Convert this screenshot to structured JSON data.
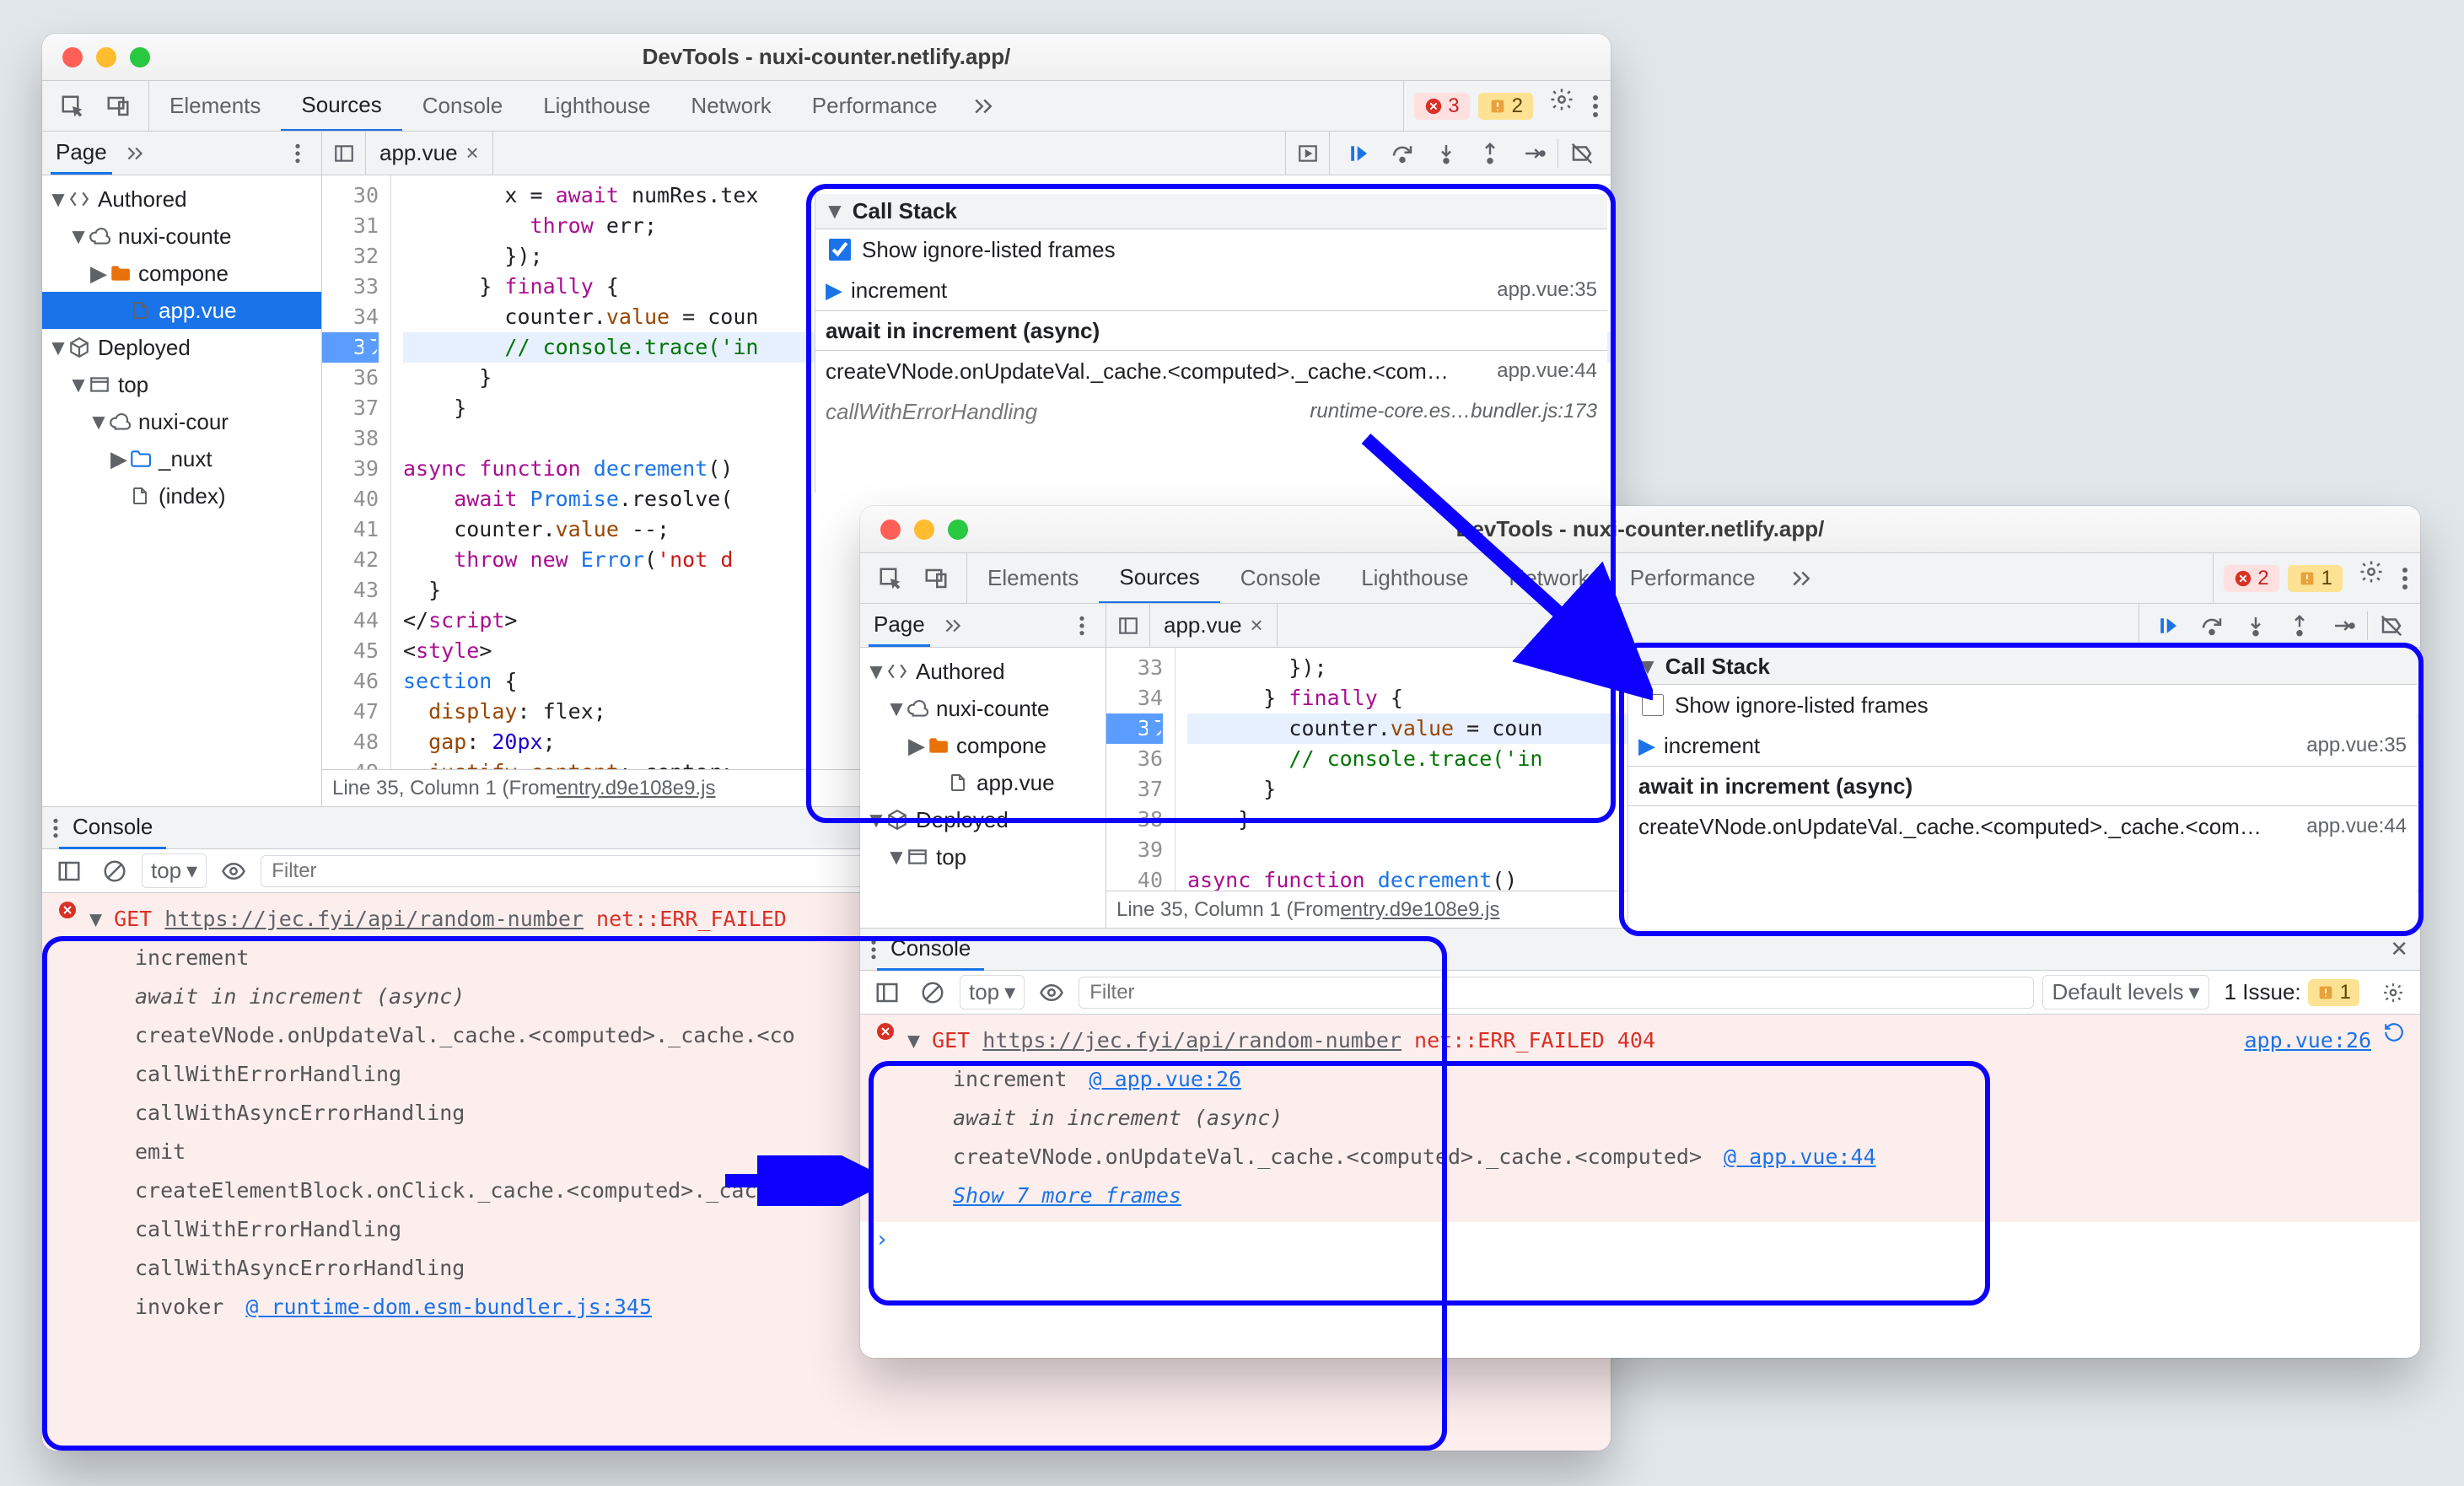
{
  "windowA": {
    "title": "DevTools - nuxi-counter.netlify.app/",
    "tabs": [
      "Elements",
      "Sources",
      "Console",
      "Lighthouse",
      "Network",
      "Performance"
    ],
    "activeTab": "Sources",
    "badges": {
      "errors": "3",
      "warnings": "2"
    },
    "pageTabLabel": "Page",
    "fileTab": "app.vue",
    "navigator": [
      {
        "depth": 0,
        "twist": "down",
        "icon": "brackets",
        "label": "Authored"
      },
      {
        "depth": 1,
        "twist": "down",
        "icon": "cloud",
        "label": "nuxi-counte"
      },
      {
        "depth": 2,
        "twist": "right",
        "icon": "folder",
        "label": "compone"
      },
      {
        "depth": 3,
        "twist": "none",
        "icon": "file",
        "label": "app.vue",
        "selected": true
      },
      {
        "depth": 0,
        "twist": "down",
        "icon": "cube",
        "label": "Deployed"
      },
      {
        "depth": 1,
        "twist": "down",
        "icon": "window",
        "label": "top"
      },
      {
        "depth": 2,
        "twist": "down",
        "icon": "cloud",
        "label": "nuxi-cour"
      },
      {
        "depth": 3,
        "twist": "right",
        "icon": "folder-b",
        "label": "_nuxt"
      },
      {
        "depth": 3,
        "twist": "none",
        "icon": "file",
        "label": "(index)"
      }
    ],
    "code": {
      "start": 30,
      "execLine": 35,
      "lines": [
        "        x = <kw>await</kw> numRes.tex",
        "          <kw>throw</kw> err;",
        "        });",
        "      } <kw>finally</kw> {",
        "        counter.<pr>value</pr> = coun",
        "        <cm>// console.trace('in</cm>",
        "      }",
        "    }",
        "",
        "<kw>async function</kw> <fn>decrement</fn>()",
        "    <kw>await</kw> <fn>Promise</fn>.resolve(",
        "    counter.<pr>value</pr> --;",
        "    <kw>throw new</kw> <fn>Error</fn>(<st>'not d</st>",
        "  }",
        "&lt;/<kw>script</kw>&gt;",
        "&lt;<kw>style</kw>&gt;",
        "<fn>section</fn> {",
        "  <pr>display</pr>: flex;",
        "  <pr>gap</pr>: <nm>20px</nm>;",
        "  <pr>justify-content</pr>: center;"
      ],
      "status": {
        "pos": "Line 35, Column 1",
        "from": "(From ",
        "link": "entry.d9e108e9.js"
      }
    },
    "callstack": {
      "title": "Call Stack",
      "checkbox": "Show ignore-listed frames",
      "checked": true,
      "rows": [
        {
          "kind": "ptr",
          "name": "increment",
          "loc": "app.vue:35"
        },
        {
          "kind": "bold",
          "name": "await in increment (async)"
        },
        {
          "kind": "wrap",
          "name": "createVNode.onUpdateVal._cache.<computed>._cache.<com…",
          "loc": "app.vue:44"
        },
        {
          "kind": "ital",
          "name": "callWithErrorHandling",
          "loc": "runtime-core.es…bundler.js:173"
        }
      ]
    },
    "console": {
      "title": "Console",
      "context": "top",
      "filterPlaceholder": "Filter",
      "err": "GET ",
      "errUrl": "https://jec.fyi/api/random-number",
      "errCode": " net::ERR_FAILED",
      "stack": [
        {
          "t": "increment"
        },
        {
          "t": "await in increment (async)",
          "ital": true
        },
        {
          "t": "createVNode.onUpdateVal._cache.<computed>._cache.<co"
        },
        {
          "t": "callWithErrorHandling"
        },
        {
          "t": "callWithAsyncErrorHandling"
        },
        {
          "t": "emit"
        },
        {
          "t": "createElementBlock.onClick._cache.<computed>._cache."
        },
        {
          "t": "callWithErrorHandling"
        },
        {
          "t": "callWithAsyncErrorHandling"
        },
        {
          "t": "invoker",
          "link": "runtime-dom.esm-bundler.js:345"
        }
      ]
    }
  },
  "windowB": {
    "title": "DevTools - nuxi-counter.netlify.app/",
    "tabs": [
      "Elements",
      "Sources",
      "Console",
      "Lighthouse",
      "Network",
      "Performance"
    ],
    "activeTab": "Sources",
    "badges": {
      "errors": "2",
      "warnings": "1"
    },
    "pageTabLabel": "Page",
    "fileTab": "app.vue",
    "navigator": [
      {
        "depth": 0,
        "twist": "down",
        "icon": "brackets",
        "label": "Authored"
      },
      {
        "depth": 1,
        "twist": "down",
        "icon": "cloud",
        "label": "nuxi-counte"
      },
      {
        "depth": 2,
        "twist": "right",
        "icon": "folder",
        "label": "compone"
      },
      {
        "depth": 3,
        "twist": "none",
        "icon": "file",
        "label": "app.vue"
      },
      {
        "depth": 0,
        "twist": "down",
        "icon": "cube",
        "label": "Deployed"
      },
      {
        "depth": 1,
        "twist": "down",
        "icon": "window",
        "label": "top"
      }
    ],
    "code": {
      "start": 33,
      "execLine": 35,
      "lines": [
        "        });",
        "      } <kw>finally</kw> {",
        "        counter.<pr>value</pr> = coun",
        "        <cm>// console.trace('in</cm>",
        "      }",
        "    }",
        "",
        "<kw>async function</kw> <fn>decrement</fn>()"
      ],
      "status": {
        "pos": "Line 35, Column 1",
        "from": "(From ",
        "link": "entry.d9e108e9.js"
      }
    },
    "callstack": {
      "title": "Call Stack",
      "checkbox": "Show ignore-listed frames",
      "checked": false,
      "rows": [
        {
          "kind": "ptr",
          "name": "increment",
          "loc": "app.vue:35"
        },
        {
          "kind": "bold",
          "name": "await in increment (async)"
        },
        {
          "kind": "wrap",
          "name": "createVNode.onUpdateVal._cache.<computed>._cache.<com…",
          "loc": "app.vue:44"
        }
      ]
    },
    "console": {
      "title": "Console",
      "context": "top",
      "filterPlaceholder": "Filter",
      "levels": "Default levels",
      "issuesLabel": "1 Issue:",
      "issuesCount": "1",
      "err": "GET ",
      "errUrl": "https://jec.fyi/api/random-number",
      "errCode": " net::ERR_FAILED 404",
      "errLink": "app.vue:26",
      "stack": [
        {
          "t": "increment",
          "link": "app.vue:26"
        },
        {
          "t": "await in increment (async)",
          "ital": true
        },
        {
          "t": "createVNode.onUpdateVal._cache.<computed>._cache.<computed>",
          "link": "app.vue:44"
        }
      ],
      "more": "Show 7 more frames"
    }
  }
}
